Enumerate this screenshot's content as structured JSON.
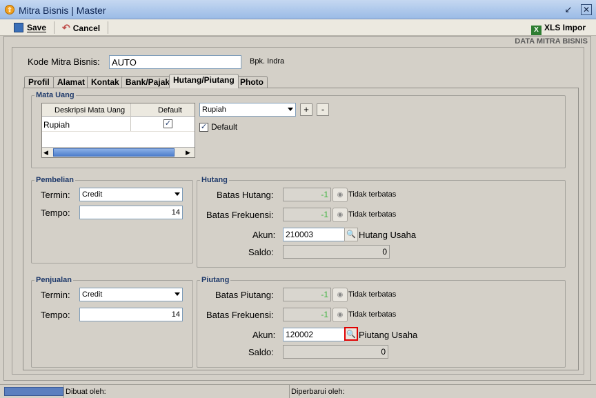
{
  "window": {
    "title": "Mitra Bisnis | Master",
    "icon": "app-icon"
  },
  "toolbar": {
    "save_label": "Save",
    "save_underline": "S",
    "cancel_label": "Cancel",
    "cancel_underline": "C",
    "xls_label": "XLS Impor"
  },
  "header": {
    "section_title": "DATA MITRA BISNIS"
  },
  "form": {
    "kode_label": "Kode Mitra Bisnis:",
    "kode_value": "AUTO",
    "user_hint": "Bpk. Indra"
  },
  "tabs": [
    {
      "label": "Profil"
    },
    {
      "label": "Alamat"
    },
    {
      "label": "Kontak"
    },
    {
      "label": "Bank/Pajak"
    },
    {
      "label": "Hutang/Piutang"
    },
    {
      "label": "Photo"
    }
  ],
  "active_tab": "Hutang/Piutang",
  "mata_uang": {
    "title": "Mata Uang",
    "columns": [
      "Deskripsi Mata Uang",
      "Default"
    ],
    "rows": [
      {
        "deskripsi": "Rupiah",
        "default": true
      }
    ],
    "select_value": "Rupiah",
    "add_label": "+",
    "remove_label": "-",
    "default_label": "Default",
    "default_checked": true
  },
  "pembelian": {
    "title": "Pembelian",
    "termin_label": "Termin:",
    "termin_value": "Credit",
    "tempo_label": "Tempo:",
    "tempo_value": "14"
  },
  "hutang": {
    "title": "Hutang",
    "batas_label": "Batas Hutang:",
    "batas_value": "-1",
    "batas_hint": "Tidak terbatas",
    "frek_label": "Batas Frekuensi:",
    "frek_value": "-1",
    "frek_hint": "Tidak terbatas",
    "akun_label": "Akun:",
    "akun_value": "210003",
    "akun_name": "Hutang Usaha",
    "saldo_label": "Saldo:",
    "saldo_value": "0"
  },
  "penjualan": {
    "title": "Penjualan",
    "termin_label": "Termin:",
    "termin_value": "Credit",
    "tempo_label": "Tempo:",
    "tempo_value": "14"
  },
  "piutang": {
    "title": "Piutang",
    "batas_label": "Batas Piutang:",
    "batas_value": "-1",
    "batas_hint": "Tidak terbatas",
    "frek_label": "Batas Frekuensi:",
    "frek_value": "-1",
    "frek_hint": "Tidak terbatas",
    "akun_label": "Akun:",
    "akun_value": "120002",
    "akun_name": "Piutang Usaha",
    "saldo_label": "Saldo:",
    "saldo_value": "0"
  },
  "status": {
    "dibuat_label": "Dibuat oleh:",
    "diperbarui_label": "Diperbarui oleh:"
  },
  "colors": {
    "accent": "#1f3a6b",
    "highlight": "#e00000",
    "positive": "#3cb43c"
  }
}
